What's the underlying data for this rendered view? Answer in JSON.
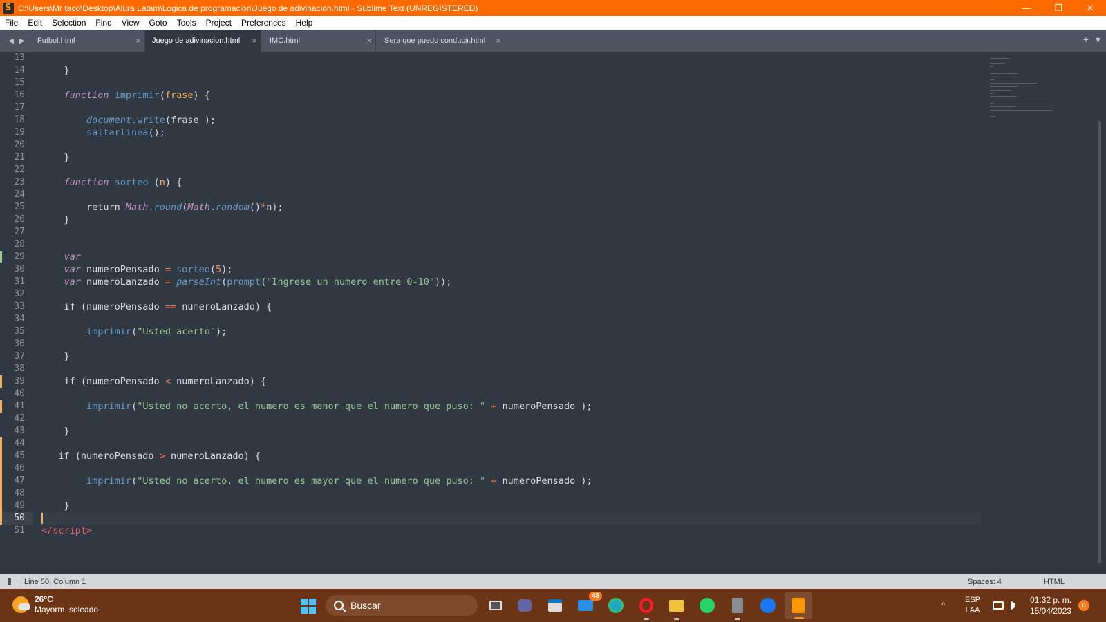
{
  "window": {
    "title": "C:\\Users\\Mr taco\\Desktop\\Alura Latam\\Logica de programacion\\Juego de adivinacion.html - Sublime Text (UNREGISTERED)",
    "minimize": "—",
    "restore": "❐",
    "close": "✕"
  },
  "menu": [
    "File",
    "Edit",
    "Selection",
    "Find",
    "View",
    "Goto",
    "Tools",
    "Project",
    "Preferences",
    "Help"
  ],
  "tabs": [
    {
      "label": "Futbol.html",
      "active": false,
      "close": "×"
    },
    {
      "label": "Juego de adivinacion.html",
      "active": true,
      "close": "×"
    },
    {
      "label": "IMC.html",
      "active": false,
      "close": "×"
    },
    {
      "label": "Sera que puedo conducir.html",
      "active": false,
      "close": "×"
    }
  ],
  "tab_tools": {
    "add": "+",
    "menu": "▾"
  },
  "nav": {
    "back": "◀",
    "forward": "▶"
  },
  "editor": {
    "current_line": 50,
    "lines": [
      {
        "n": "13",
        "mod": "",
        "html": ""
      },
      {
        "n": "14",
        "mod": "",
        "html": "    }"
      },
      {
        "n": "15",
        "mod": "",
        "html": ""
      },
      {
        "n": "16",
        "mod": "",
        "html": "    <span class=\"kw\">function</span> <span class=\"fn\">imprimir</span>(<span class=\"par\">frase</span>) {"
      },
      {
        "n": "17",
        "mod": "",
        "html": ""
      },
      {
        "n": "18",
        "mod": "",
        "html": "        <span class=\"fni\">document</span><span class=\"pn\">.</span><span class=\"fn\">write</span>(frase );"
      },
      {
        "n": "19",
        "mod": "",
        "html": "        <span class=\"fn\">saltarlinea</span>();"
      },
      {
        "n": "20",
        "mod": "",
        "html": ""
      },
      {
        "n": "21",
        "mod": "",
        "html": "    }"
      },
      {
        "n": "22",
        "mod": "",
        "html": ""
      },
      {
        "n": "23",
        "mod": "",
        "html": "    <span class=\"kw\">function</span> <span class=\"fn\">sorteo</span> (<span class=\"par\">n</span>) {"
      },
      {
        "n": "24",
        "mod": "",
        "html": ""
      },
      {
        "n": "25",
        "mod": "",
        "html": "        return <span class=\"cls\">Math</span><span class=\"pn\">.</span><span class=\"fni\">round</span>(<span class=\"cls\">Math</span><span class=\"pn\">.</span><span class=\"fni\">random</span>()<span class=\"op\">*</span>n);"
      },
      {
        "n": "26",
        "mod": "",
        "html": "    }"
      },
      {
        "n": "27",
        "mod": "",
        "html": ""
      },
      {
        "n": "28",
        "mod": "",
        "html": ""
      },
      {
        "n": "29",
        "mod": "add",
        "html": "    <span class=\"kw\">var</span>"
      },
      {
        "n": "30",
        "mod": "",
        "html": "    <span class=\"kw\">var</span> numeroPensado <span class=\"op\">=</span> <span class=\"fn\">sorteo</span>(<span class=\"num\">5</span>);"
      },
      {
        "n": "31",
        "mod": "",
        "html": "    <span class=\"kw\">var</span> numeroLanzado <span class=\"op\">=</span> <span class=\"fni\">parseInt</span>(<span class=\"fn\">prompt</span>(<span class=\"str\">\"Ingrese un numero entre 0-10\"</span>));"
      },
      {
        "n": "32",
        "mod": "",
        "html": ""
      },
      {
        "n": "33",
        "mod": "",
        "html": "    if (numeroPensado <span class=\"op\">==</span> numeroLanzado) {"
      },
      {
        "n": "34",
        "mod": "",
        "html": ""
      },
      {
        "n": "35",
        "mod": "",
        "html": "        <span class=\"fn\">imprimir</span>(<span class=\"str\">\"Usted acerto\"</span>);"
      },
      {
        "n": "36",
        "mod": "",
        "html": ""
      },
      {
        "n": "37",
        "mod": "",
        "html": "    }"
      },
      {
        "n": "38",
        "mod": "",
        "html": ""
      },
      {
        "n": "39",
        "mod": "chg",
        "html": "    if (numeroPensado <span class=\"op\">&lt;</span> numeroLanzado) {"
      },
      {
        "n": "40",
        "mod": "",
        "html": ""
      },
      {
        "n": "41",
        "mod": "chg",
        "html": "        <span class=\"fn\">imprimir</span>(<span class=\"str\">\"Usted no acerto, el numero es menor que el numero que puso: \"</span> <span class=\"op\">+</span> numeroPensado );"
      },
      {
        "n": "42",
        "mod": "",
        "html": ""
      },
      {
        "n": "43",
        "mod": "",
        "html": "    }"
      },
      {
        "n": "44",
        "mod": "chg",
        "html": ""
      },
      {
        "n": "45",
        "mod": "chg",
        "html": "   if (numeroPensado <span class=\"op\">&gt;</span> numeroLanzado) {"
      },
      {
        "n": "46",
        "mod": "chg",
        "html": ""
      },
      {
        "n": "47",
        "mod": "chg",
        "html": "        <span class=\"fn\">imprimir</span>(<span class=\"str\">\"Usted no acerto, el numero es mayor que el numero que puso: \"</span> <span class=\"op\">+</span> numeroPensado );"
      },
      {
        "n": "48",
        "mod": "chg",
        "html": ""
      },
      {
        "n": "49",
        "mod": "chg",
        "html": "    }"
      },
      {
        "n": "50",
        "mod": "chg",
        "html": "<span class=\"caret\"></span>"
      },
      {
        "n": "51",
        "mod": "",
        "html": "<span class=\"tag\">&lt;/script&gt;</span>"
      }
    ]
  },
  "status": {
    "position": "Line 50, Column 1",
    "spaces": "Spaces: 4",
    "syntax": "HTML"
  },
  "taskbar": {
    "weather_temp": "26°C",
    "weather_desc": "Mayorm. soleado",
    "search_placeholder": "Buscar",
    "mail_badge": "48",
    "lang_top": "ESP",
    "lang_bottom": "LAA",
    "time": "01:32 p. m.",
    "date": "15/04/2023",
    "notifications": "6",
    "tray_chevron": "^"
  },
  "colors": {
    "titlebar": "#ff6a00",
    "editor_bg": "#303841",
    "gutter_added": "#99c794",
    "gutter_modified": "#f9ae58",
    "taskbar": "#6b3515"
  }
}
